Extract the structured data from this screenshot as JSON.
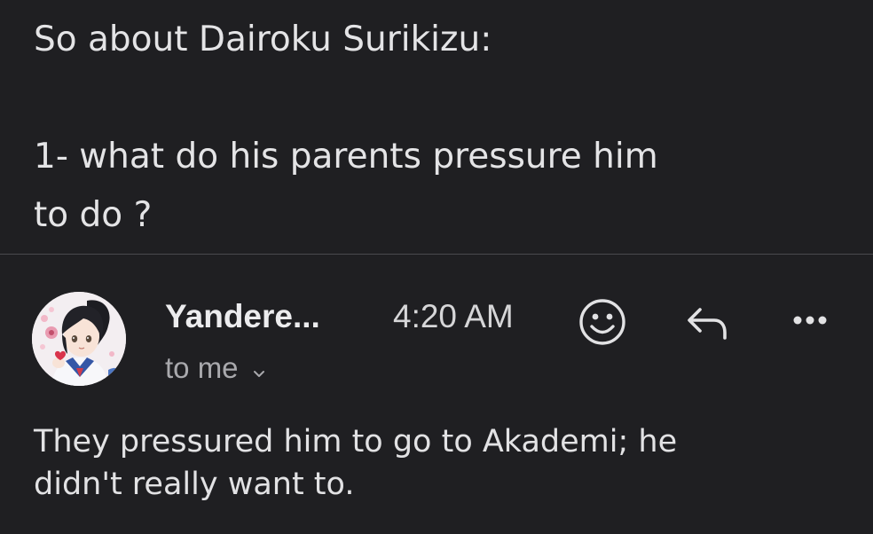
{
  "quoted_message": {
    "line1": "So about Dairoku Surikizu:",
    "line2": "1- what do his parents pressure him",
    "line3": "to do ?"
  },
  "reply": {
    "sender": "Yandere...",
    "time": "4:20 AM",
    "recipient": "to me",
    "body_line1": "They pressured him to go to Akademi; he",
    "body_line2": "didn't really want to."
  },
  "icons": {
    "avatar": "anime-character-avatar",
    "emoji": "smiley-face-icon",
    "reply": "reply-arrow-icon",
    "more": "more-horizontal-icon",
    "chevron": "chevron-down-icon"
  },
  "colors": {
    "background": "#1f1f22",
    "divider": "#4a4a4e",
    "text_primary": "#e6e6e8",
    "text_secondary": "#a9a9ad"
  }
}
